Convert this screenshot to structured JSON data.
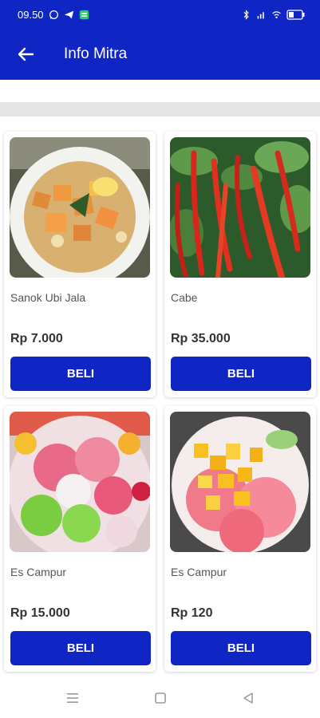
{
  "status_bar": {
    "time": "09.50",
    "icons": [
      "whatsapp-icon",
      "telegram-icon",
      "app-notification-icon",
      "bluetooth-icon",
      "signal-icon",
      "wifi-icon",
      "battery-icon"
    ]
  },
  "app_bar": {
    "title": "Info Mitra",
    "back_icon": "arrow-left-icon",
    "background": "#0f26c4"
  },
  "products": [
    {
      "name": "Sanok Ubi Jala",
      "price": "Rp 7.000",
      "button": "BELI",
      "image": "sweet-potato-curry-photo"
    },
    {
      "name": "Cabe",
      "price": "Rp 35.000",
      "button": "BELI",
      "image": "red-chili-photo"
    },
    {
      "name": "Es Campur",
      "price": "Rp 15.000",
      "button": "BELI",
      "image": "mixed-ice-dessert-photo"
    },
    {
      "name": "Es Campur",
      "price": "Rp 120",
      "button": "BELI",
      "image": "mango-ice-dessert-photo"
    }
  ],
  "nav_bar": {
    "icons": [
      "menu-icon",
      "home-square-icon",
      "back-triangle-icon"
    ]
  },
  "colors": {
    "primary": "#0f26c4",
    "band": "#e6e6e6"
  }
}
